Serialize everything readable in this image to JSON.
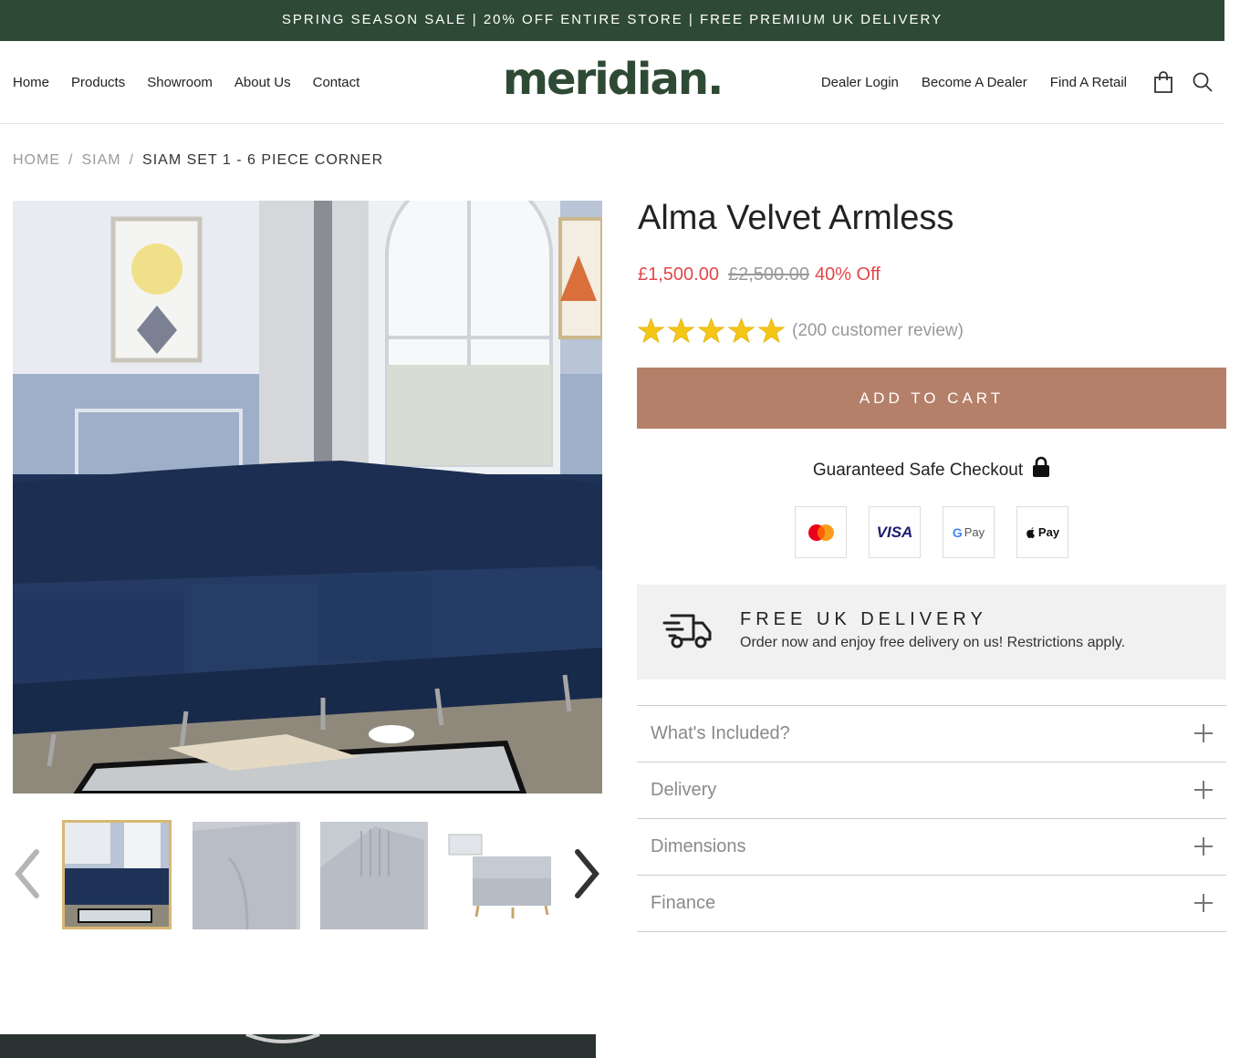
{
  "announcement": "SPRING SEASON SALE | 20% OFF ENTIRE STORE | FREE PREMIUM UK DELIVERY",
  "header": {
    "logo": "meridian.",
    "nav_left": [
      "Home",
      "Products",
      "Showroom",
      "About Us",
      "Contact"
    ],
    "nav_right": [
      "Dealer Login",
      "Become A Dealer",
      "Find A Retail"
    ],
    "icons": [
      "shopping-bag-icon",
      "search-icon"
    ]
  },
  "breadcrumb": {
    "items": [
      "HOME",
      "SIAM",
      "SIAM SET 1 - 6 PIECE CORNER"
    ],
    "separator": "/"
  },
  "product": {
    "title": "Alma Velvet Armless",
    "price": "£1,500.00",
    "compare_price": "£2,500.00",
    "discount": "40% Off",
    "rating": 5,
    "review_text": "(200 customer review)",
    "add_to_cart": "ADD TO CART",
    "safe_checkout": "Guaranteed Safe Checkout",
    "payments": {
      "visa": "VISA",
      "gpay": "Pay",
      "apay": "Pay"
    }
  },
  "delivery": {
    "title": "FREE UK DELIVERY",
    "description": "Order now and enjoy free delivery on us! Restrictions apply."
  },
  "accordion": [
    "What's Included?",
    "Delivery",
    "Dimensions",
    "Finance"
  ],
  "colors": {
    "brand_green": "#2f4a34",
    "cta": "#b5806a",
    "sale_red": "#e2474b",
    "star": "#f5c518",
    "sofa_navy": "#1f3358"
  }
}
